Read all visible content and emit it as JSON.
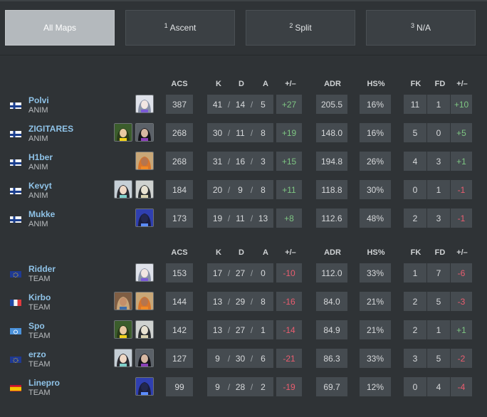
{
  "colors": {
    "background": "#2f3336",
    "cell": "#454b50",
    "name_link": "#8fc3e8",
    "positive": "#7ec682",
    "negative": "#ea5d6f",
    "active_tab": "#b4b9bd"
  },
  "tabs": [
    {
      "num": "",
      "label": "All Maps",
      "active": true
    },
    {
      "num": "1",
      "label": "Ascent",
      "active": false
    },
    {
      "num": "2",
      "label": "Split",
      "active": false
    },
    {
      "num": "3",
      "label": "N/A",
      "active": false
    }
  ],
  "columns": {
    "acs": "ACS",
    "k": "K",
    "d": "D",
    "a": "A",
    "pm": "+/–",
    "adr": "ADR",
    "hs": "HS%",
    "fk": "FK",
    "fd": "FD",
    "fkpm": "+/–"
  },
  "teams": [
    {
      "players": [
        {
          "name": "Polvi",
          "team": "ANIM",
          "flag": "fi",
          "agents": [
            "astra"
          ],
          "acs": "387",
          "k": "41",
          "d": "14",
          "a": "5",
          "pm": "+27",
          "adr": "205.5",
          "hs": "16%",
          "fk": "11",
          "fd": "1",
          "fkpm": "+10"
        },
        {
          "name": "ZIGITARES",
          "team": "ANIM",
          "flag": "fi",
          "agents": [
            "killjoy",
            "reyna"
          ],
          "acs": "268",
          "k": "30",
          "d": "11",
          "a": "8",
          "pm": "+19",
          "adr": "148.0",
          "hs": "16%",
          "fk": "5",
          "fd": "0",
          "fkpm": "+5"
        },
        {
          "name": "H1ber",
          "team": "ANIM",
          "flag": "fi",
          "agents": [
            "raze"
          ],
          "acs": "268",
          "k": "31",
          "d": "16",
          "a": "3",
          "pm": "+15",
          "adr": "194.8",
          "hs": "26%",
          "fk": "4",
          "fd": "3",
          "fkpm": "+1"
        },
        {
          "name": "Kevyt",
          "team": "ANIM",
          "flag": "fi",
          "agents": [
            "sage",
            "cypher"
          ],
          "acs": "184",
          "k": "20",
          "d": "9",
          "a": "8",
          "pm": "+11",
          "adr": "118.8",
          "hs": "30%",
          "fk": "0",
          "fd": "1",
          "fkpm": "-1"
        },
        {
          "name": "Mukke",
          "team": "ANIM",
          "flag": "fi",
          "agents": [
            "omen"
          ],
          "acs": "173",
          "k": "19",
          "d": "11",
          "a": "13",
          "pm": "+8",
          "adr": "112.6",
          "hs": "48%",
          "fk": "2",
          "fd": "3",
          "fkpm": "-1"
        }
      ]
    },
    {
      "players": [
        {
          "name": "Ridder",
          "team": "TEAM",
          "flag": "eu",
          "agents": [
            "astra"
          ],
          "acs": "153",
          "k": "17",
          "d": "27",
          "a": "0",
          "pm": "-10",
          "adr": "112.0",
          "hs": "33%",
          "fk": "1",
          "fd": "7",
          "fkpm": "-6"
        },
        {
          "name": "Kirbo",
          "team": "TEAM",
          "flag": "fr",
          "agents": [
            "sova",
            "raze"
          ],
          "acs": "144",
          "k": "13",
          "d": "29",
          "a": "8",
          "pm": "-16",
          "adr": "84.0",
          "hs": "21%",
          "fk": "2",
          "fd": "5",
          "fkpm": "-3"
        },
        {
          "name": "Spo",
          "team": "TEAM",
          "flag": "un",
          "agents": [
            "killjoy",
            "cypher"
          ],
          "acs": "142",
          "k": "13",
          "d": "27",
          "a": "1",
          "pm": "-14",
          "adr": "84.9",
          "hs": "21%",
          "fk": "2",
          "fd": "1",
          "fkpm": "+1"
        },
        {
          "name": "erzo",
          "team": "TEAM",
          "flag": "eu",
          "agents": [
            "sage",
            "reyna"
          ],
          "acs": "127",
          "k": "9",
          "d": "30",
          "a": "6",
          "pm": "-21",
          "adr": "86.3",
          "hs": "33%",
          "fk": "3",
          "fd": "5",
          "fkpm": "-2"
        },
        {
          "name": "Linepro",
          "team": "TEAM",
          "flag": "es",
          "agents": [
            "omen"
          ],
          "acs": "99",
          "k": "9",
          "d": "28",
          "a": "2",
          "pm": "-19",
          "adr": "69.7",
          "hs": "12%",
          "fk": "0",
          "fd": "4",
          "fkpm": "-4"
        }
      ]
    }
  ]
}
